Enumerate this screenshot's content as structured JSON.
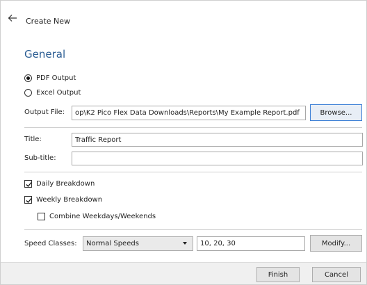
{
  "header": {
    "title": "Create New"
  },
  "section": {
    "title": "General"
  },
  "output_type": {
    "options": [
      "PDF Output",
      "Excel Output"
    ],
    "selected": "PDF Output"
  },
  "output_file": {
    "label": "Output File:",
    "value": "op\\K2 Pico Flex Data Downloads\\Reports\\My Example Report.pdf",
    "browse_label": "Browse..."
  },
  "title_field": {
    "label": "Title:",
    "value": "Traffic Report"
  },
  "subtitle_field": {
    "label": "Sub-title:",
    "value": ""
  },
  "breakdown": {
    "daily": {
      "label": "Daily Breakdown",
      "checked": true
    },
    "weekly": {
      "label": "Weekly Breakdown",
      "checked": true
    },
    "combine": {
      "label": "Combine Weekdays/Weekends",
      "checked": false
    }
  },
  "speed_classes": {
    "label": "Speed Classes:",
    "selected": "Normal Speeds",
    "values": "10, 20, 30",
    "modify_label": "Modify..."
  },
  "footer": {
    "finish_label": "Finish",
    "cancel_label": "Cancel"
  },
  "colors": {
    "section_title": "#2b5d93",
    "focus_border": "#3b7fd6",
    "footer_bg": "#f0f0f0"
  },
  "icons": {
    "back": "arrow-left-icon",
    "dropdown": "chevron-down-icon",
    "check": "check-icon"
  }
}
